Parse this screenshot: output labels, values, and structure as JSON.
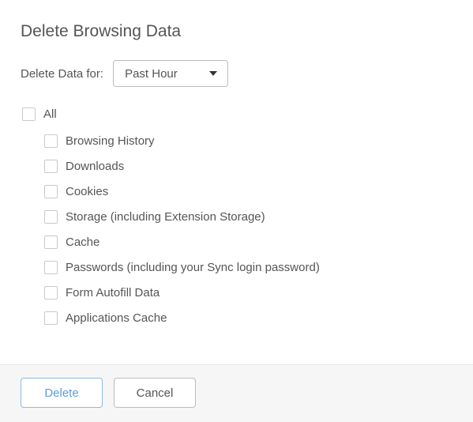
{
  "title": "Delete Browsing Data",
  "selector": {
    "label": "Delete Data for:",
    "selected": "Past Hour"
  },
  "all": {
    "label": "All",
    "checked": false
  },
  "items": [
    {
      "label": "Browsing History",
      "checked": false
    },
    {
      "label": "Downloads",
      "checked": false
    },
    {
      "label": "Cookies",
      "checked": false
    },
    {
      "label": "Storage (including Extension Storage)",
      "checked": false
    },
    {
      "label": "Cache",
      "checked": false
    },
    {
      "label": "Passwords (including your Sync login password)",
      "checked": false
    },
    {
      "label": "Form Autofill Data",
      "checked": false
    },
    {
      "label": "Applications Cache",
      "checked": false
    }
  ],
  "buttons": {
    "delete": "Delete",
    "cancel": "Cancel"
  }
}
